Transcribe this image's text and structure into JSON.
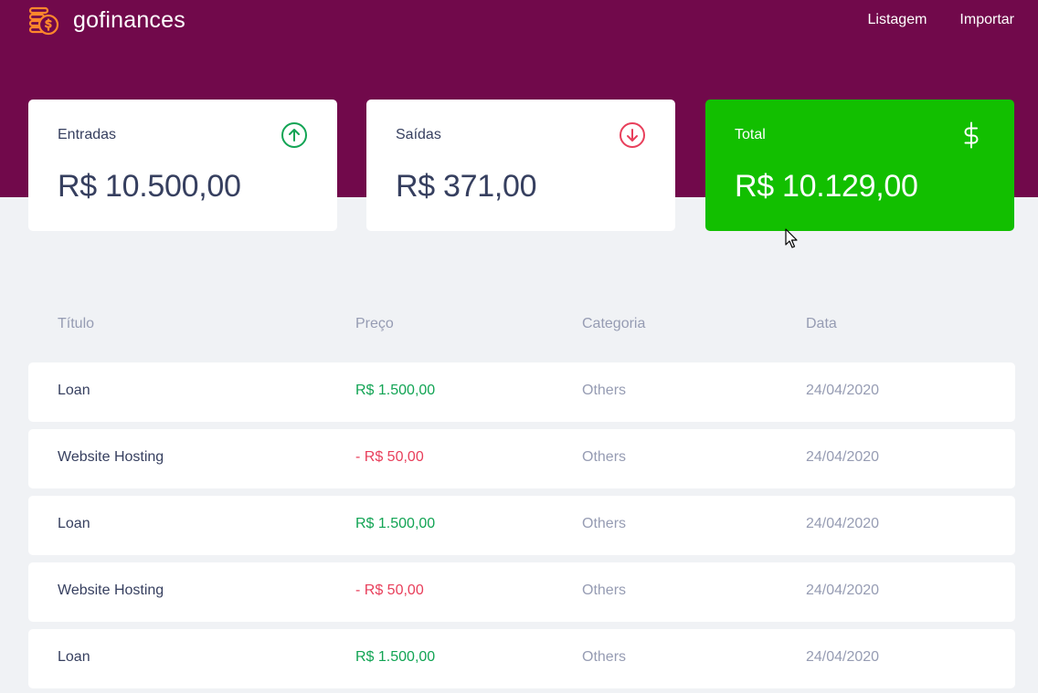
{
  "header": {
    "brand": "gofinances",
    "nav": [
      "Listagem",
      "Importar"
    ]
  },
  "cards": {
    "income": {
      "label": "Entradas",
      "value": "R$ 10.500,00",
      "icon": "arrow-up-circle-icon"
    },
    "outcome": {
      "label": "Saídas",
      "value": "R$ 371,00",
      "icon": "arrow-down-circle-icon"
    },
    "total": {
      "label": "Total",
      "value": "R$ 10.129,00",
      "icon": "dollar-sign-icon"
    }
  },
  "table": {
    "columns": [
      "Título",
      "Preço",
      "Categoria",
      "Data"
    ],
    "rows": [
      {
        "title": "Loan",
        "price": "R$ 1.500,00",
        "type": "income",
        "category": "Others",
        "date": "24/04/2020"
      },
      {
        "title": "Website Hosting",
        "price": "- R$ 50,00",
        "type": "outcome",
        "category": "Others",
        "date": "24/04/2020"
      },
      {
        "title": "Loan",
        "price": "R$ 1.500,00",
        "type": "income",
        "category": "Others",
        "date": "24/04/2020"
      },
      {
        "title": "Website Hosting",
        "price": "- R$ 50,00",
        "type": "outcome",
        "category": "Others",
        "date": "24/04/2020"
      },
      {
        "title": "Loan",
        "price": "R$ 1.500,00",
        "type": "income",
        "category": "Others",
        "date": "24/04/2020"
      }
    ]
  },
  "colors": {
    "header": "#71094b",
    "total_card": "#12bf00",
    "income": "#12a454",
    "outcome": "#e83f5b",
    "text": "#363f5f",
    "muted": "#969cb3"
  }
}
